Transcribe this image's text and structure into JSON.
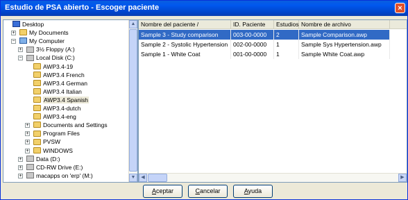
{
  "window": {
    "title": "Estudio de PSA abierto - Escoger paciente",
    "close_label": "×"
  },
  "tree": {
    "items": [
      {
        "label": "Desktop",
        "icon": "desktop-icon",
        "expander": ""
      },
      {
        "label": "My Documents",
        "icon": "folder-icon",
        "expander": "+"
      },
      {
        "label": "My Computer",
        "icon": "computer-icon",
        "expander": "−"
      },
      {
        "label": "3½ Floppy (A:)",
        "icon": "floppy-drive-icon",
        "expander": "+"
      },
      {
        "label": "Local Disk (C:)",
        "icon": "hard-drive-icon",
        "expander": "−"
      },
      {
        "label": "AWP3.4-19",
        "icon": "folder-icon",
        "expander": ""
      },
      {
        "label": "AWP3.4 French",
        "icon": "folder-icon",
        "expander": ""
      },
      {
        "label": "AWP3.4 German",
        "icon": "folder-icon",
        "expander": ""
      },
      {
        "label": "AWP3.4 Italian",
        "icon": "folder-icon",
        "expander": ""
      },
      {
        "label": "AWP3.4 Spanish",
        "icon": "folder-open-icon",
        "expander": ""
      },
      {
        "label": "AWP3.4-dutch",
        "icon": "folder-icon",
        "expander": ""
      },
      {
        "label": "AWP3.4-eng",
        "icon": "folder-icon",
        "expander": ""
      },
      {
        "label": "Documents and Settings",
        "icon": "folder-icon",
        "expander": "+"
      },
      {
        "label": "Program Files",
        "icon": "folder-icon",
        "expander": "+"
      },
      {
        "label": "PVSW",
        "icon": "folder-icon",
        "expander": "+"
      },
      {
        "label": "WINDOWS",
        "icon": "folder-icon",
        "expander": "+"
      },
      {
        "label": "Data (D:)",
        "icon": "hard-drive-icon",
        "expander": "+"
      },
      {
        "label": "CD-RW Drive (E:)",
        "icon": "cd-drive-icon",
        "expander": "+"
      },
      {
        "label": "macapps on 'erp' (M:)",
        "icon": "network-drive-icon",
        "expander": "+"
      }
    ],
    "selected_index": 9
  },
  "table": {
    "columns": [
      "Nombre del paciente /",
      "ID. Paciente",
      "Estudios",
      "Nombre de archivo"
    ],
    "rows": [
      [
        "Sample 3 - Study comparison",
        "003-00-0000",
        "2",
        "Sample Comparison.awp"
      ],
      [
        "Sample 2 - Systolic Hypertension",
        "002-00-0000",
        "1",
        "Sample Sys Hypertension.awp"
      ],
      [
        "Sample 1 - White Coat",
        "001-00-0000",
        "1",
        "Sample White Coat.awp"
      ]
    ],
    "selected_row": 0
  },
  "buttons": {
    "accept": {
      "first": "A",
      "rest": "ceptar"
    },
    "cancel": {
      "first": "C",
      "rest": "ancelar"
    },
    "help": {
      "first": "A",
      "rest": "yuda"
    }
  },
  "scroll": {
    "up": "▲",
    "down": "▼",
    "left": "◀",
    "right": "▶"
  },
  "colors": {
    "titlebar": "#0058ee",
    "selection": "#316ac5",
    "close": "#e0502a"
  }
}
